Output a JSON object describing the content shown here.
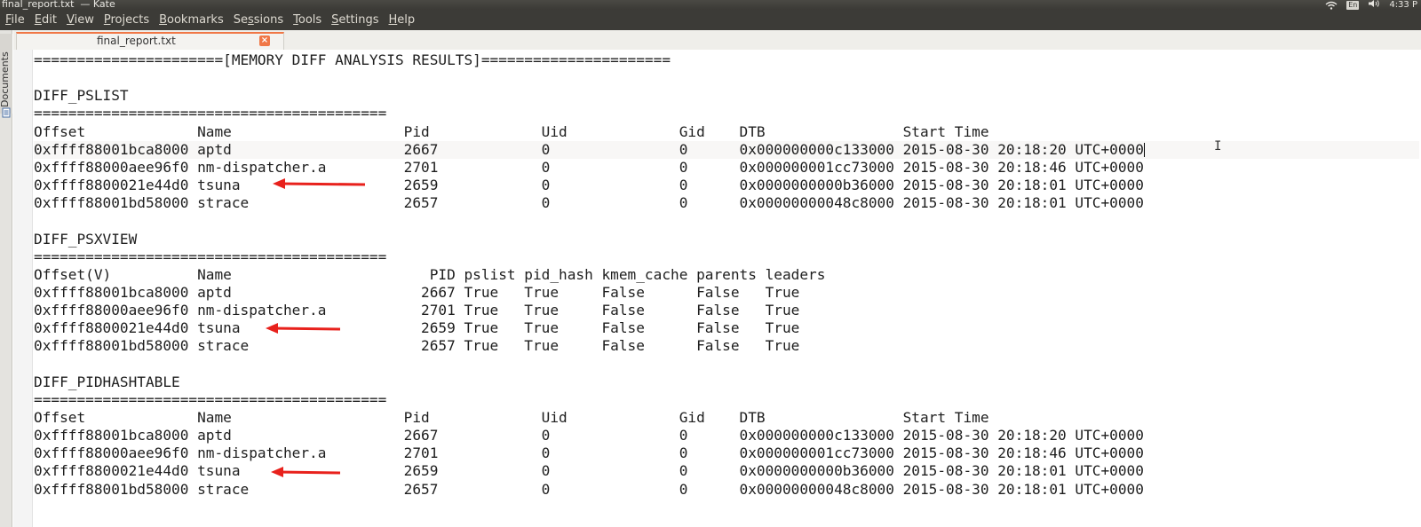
{
  "window": {
    "title": "final_report.txt  — Kate",
    "clock": "4:33 P",
    "keyboard_layout": "En"
  },
  "menu": {
    "items": [
      {
        "pre": "",
        "u": "F",
        "post": "ile"
      },
      {
        "pre": "",
        "u": "E",
        "post": "dit"
      },
      {
        "pre": "",
        "u": "V",
        "post": "iew"
      },
      {
        "pre": "",
        "u": "P",
        "post": "rojects"
      },
      {
        "pre": "",
        "u": "B",
        "post": "ookmarks"
      },
      {
        "pre": "Se",
        "u": "s",
        "post": "sions"
      },
      {
        "pre": "",
        "u": "T",
        "post": "ools"
      },
      {
        "pre": "",
        "u": "S",
        "post": "ettings"
      },
      {
        "pre": "",
        "u": "H",
        "post": "elp"
      }
    ]
  },
  "sidebar": {
    "documents_label": "Documents"
  },
  "tab": {
    "label": "final_report.txt",
    "close_glyph": "×"
  },
  "accent_color": "#f07746",
  "arrow_color": "#e8211c",
  "document": {
    "lines": [
      "======================[MEMORY DIFF ANALYSIS RESULTS]======================",
      "",
      "DIFF_PSLIST",
      "=========================================",
      "Offset             Name                    Pid             Uid             Gid    DTB                Start Time",
      "0xffff88001bca8000 aptd                    2667            0               0      0x000000000c133000 2015-08-30 20:18:20 UTC+0000",
      "0xffff88000aee96f0 nm-dispatcher.a         2701            0               0      0x000000001cc73000 2015-08-30 20:18:46 UTC+0000",
      "0xffff8800021e44d0 tsuna                   2659            0               0      0x0000000000b36000 2015-08-30 20:18:01 UTC+0000",
      "0xffff88001bd58000 strace                  2657            0               0      0x00000000048c8000 2015-08-30 20:18:01 UTC+0000",
      "",
      "DIFF_PSXVIEW",
      "=========================================",
      "Offset(V)          Name                       PID pslist pid_hash kmem_cache parents leaders",
      "0xffff88001bca8000 aptd                      2667 True   True     False      False   True",
      "0xffff88000aee96f0 nm-dispatcher.a           2701 True   True     False      False   True",
      "0xffff8800021e44d0 tsuna                     2659 True   True     False      False   True",
      "0xffff88001bd58000 strace                    2657 True   True     False      False   True",
      "",
      "DIFF_PIDHASHTABLE",
      "=========================================",
      "Offset             Name                    Pid             Uid             Gid    DTB                Start Time",
      "0xffff88001bca8000 aptd                    2667            0               0      0x000000000c133000 2015-08-30 20:18:20 UTC+0000",
      "0xffff88000aee96f0 nm-dispatcher.a         2701            0               0      0x000000001cc73000 2015-08-30 20:18:46 UTC+0000",
      "0xffff8800021e44d0 tsuna                   2659            0               0      0x0000000000b36000 2015-08-30 20:18:01 UTC+0000",
      "0xffff88001bd58000 strace                  2657            0               0      0x00000000048c8000 2015-08-30 20:18:01 UTC+0000"
    ]
  }
}
